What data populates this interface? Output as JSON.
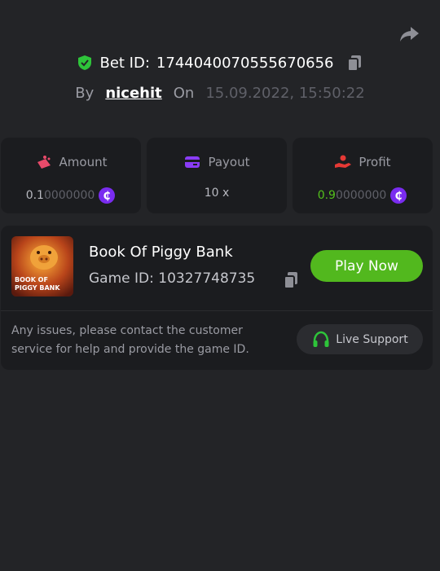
{
  "header": {
    "bet_label": "Bet ID:",
    "bet_id": "1744040070555670656",
    "by_label": "By",
    "username": "nicehit",
    "on_label": "On",
    "date": "15.09.2022, 15:50:22"
  },
  "stats": {
    "amount": {
      "label": "Amount",
      "value_main": "0.1",
      "value_rest": "0000000"
    },
    "payout": {
      "label": "Payout",
      "value": "10 x"
    },
    "profit": {
      "label": "Profit",
      "value_main": "0.9",
      "value_rest": "0000000"
    }
  },
  "game": {
    "name": "Book Of Piggy Bank",
    "id_label": "Game ID:",
    "id": "10327748735",
    "thumb_text_line1": "BOOK OF",
    "thumb_text_line2": "PIGGY BANK",
    "play_label": "Play Now"
  },
  "support": {
    "note": "Any issues, please contact the customer service for help and provide the game ID.",
    "button_label": "Live Support"
  },
  "colors": {
    "background": "#232427",
    "card": "#1b1c1f",
    "accent_green": "#52b81e",
    "coin_purple": "#7a2cf0"
  },
  "icons": [
    "share-icon",
    "shield-check-icon",
    "copy-icon",
    "amount-icon",
    "payout-card-icon",
    "profit-hand-icon",
    "coin-icon",
    "headset-icon"
  ]
}
